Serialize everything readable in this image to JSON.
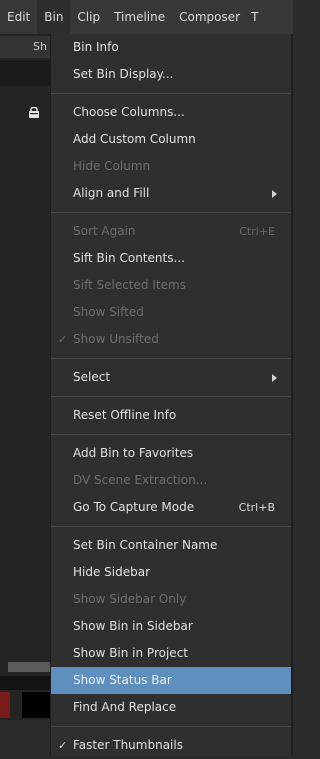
{
  "menubar": {
    "items": [
      "Edit",
      "Bin",
      "Clip",
      "Timeline",
      "Composer",
      "T"
    ]
  },
  "background": {
    "tab_fragment": "Sh"
  },
  "bin_menu": {
    "items": [
      {
        "label": "Bin Info",
        "enabled": true
      },
      {
        "label": "Set Bin Display...",
        "enabled": true
      },
      {
        "label": "Choose Columns...",
        "enabled": true
      },
      {
        "label": "Add Custom Column",
        "enabled": true
      },
      {
        "label": "Hide Column",
        "enabled": false
      },
      {
        "label": "Align and Fill",
        "enabled": true,
        "submenu": true
      },
      {
        "label": "Sort Again",
        "enabled": false,
        "shortcut": "Ctrl+E"
      },
      {
        "label": "Sift Bin Contents...",
        "enabled": true
      },
      {
        "label": "Sift Selected Items",
        "enabled": false
      },
      {
        "label": "Show Sifted",
        "enabled": false
      },
      {
        "label": "Show Unsifted",
        "enabled": false,
        "checked": true
      },
      {
        "label": "Select",
        "enabled": true,
        "submenu": true
      },
      {
        "label": "Reset Offline Info",
        "enabled": true
      },
      {
        "label": "Add Bin to Favorites",
        "enabled": true
      },
      {
        "label": "DV Scene Extraction...",
        "enabled": false
      },
      {
        "label": "Go To Capture Mode",
        "enabled": true,
        "shortcut": "Ctrl+B"
      },
      {
        "label": "Set Bin Container Name",
        "enabled": true
      },
      {
        "label": "Hide Sidebar",
        "enabled": true
      },
      {
        "label": "Show Sidebar Only",
        "enabled": false
      },
      {
        "label": "Show Bin in Sidebar",
        "enabled": true
      },
      {
        "label": "Show Bin in Project",
        "enabled": true
      },
      {
        "label": "Show Status Bar",
        "enabled": true,
        "highlighted": true
      },
      {
        "label": "Find And Replace",
        "enabled": true
      },
      {
        "label": "Faster Thumbnails",
        "enabled": true,
        "checked": true
      }
    ],
    "check_glyph": "✓"
  },
  "colors": {
    "highlight": "#5d8fbf",
    "menu_bg": "#2f2f2f",
    "menubar_bg": "#383838"
  }
}
